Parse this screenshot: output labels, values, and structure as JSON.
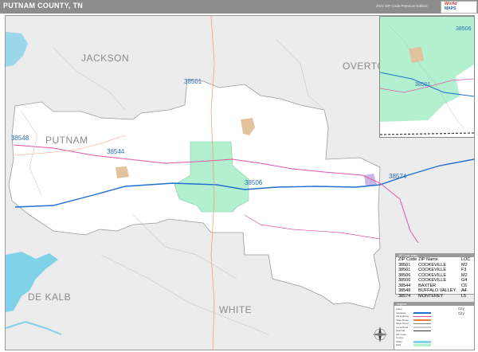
{
  "header": {
    "title": "PUTNAM COUNTY, TN",
    "edition": "2021 ZIP Code Premium Edition",
    "logo_line1": "World",
    "logo_line2": "MAPS"
  },
  "colors": {
    "header_bg": "#8c8c8c",
    "outside_county": "#ececec",
    "county_fill": "#ffffff",
    "water": "#7fd2e8",
    "zip_highlight": "#b3f0d0",
    "urban": "#e3c29e",
    "interstate": "#1e6fd0",
    "us_highway": "#e056a6",
    "state_route": "#f07b3f",
    "zip_label": "#2c6db5",
    "county_label": "#8a8a8a"
  },
  "map": {
    "county_labels": [
      "JACKSON",
      "OVERTO",
      "PUTNAM",
      "DE KALB",
      "WHITE"
    ],
    "zip_labels": [
      "38501",
      "38548",
      "38544",
      "38506",
      "38574"
    ]
  },
  "inset": {
    "zip_labels": [
      "38506",
      "38501"
    ]
  },
  "zip_table": {
    "title": "ZIP Code Index",
    "headers": [
      "ZIP Code",
      "ZIP Name",
      "LOC"
    ],
    "rows": [
      [
        "38501",
        "COOKEVILLE",
        "M2"
      ],
      [
        "38501",
        "COOKEVILLE",
        "F3"
      ],
      [
        "38506",
        "COOKEVILLE",
        "M2"
      ],
      [
        "38506",
        "COOKEVILLE",
        "G4"
      ],
      [
        "38544",
        "BAXTER",
        "C6"
      ],
      [
        "38548",
        "BUFFALO VALLEY",
        "A4"
      ],
      [
        "38574",
        "MONTEREY",
        "L5"
      ]
    ]
  },
  "legend": {
    "title": "Legend",
    "labels": [
      "Cities",
      "Interstate",
      "US Highway",
      "State Route",
      "Major Road",
      "Local Road",
      "Railroad",
      "ZIP Code",
      "County",
      "Water",
      "Park"
    ],
    "city_marks": [
      "City",
      "City"
    ]
  }
}
